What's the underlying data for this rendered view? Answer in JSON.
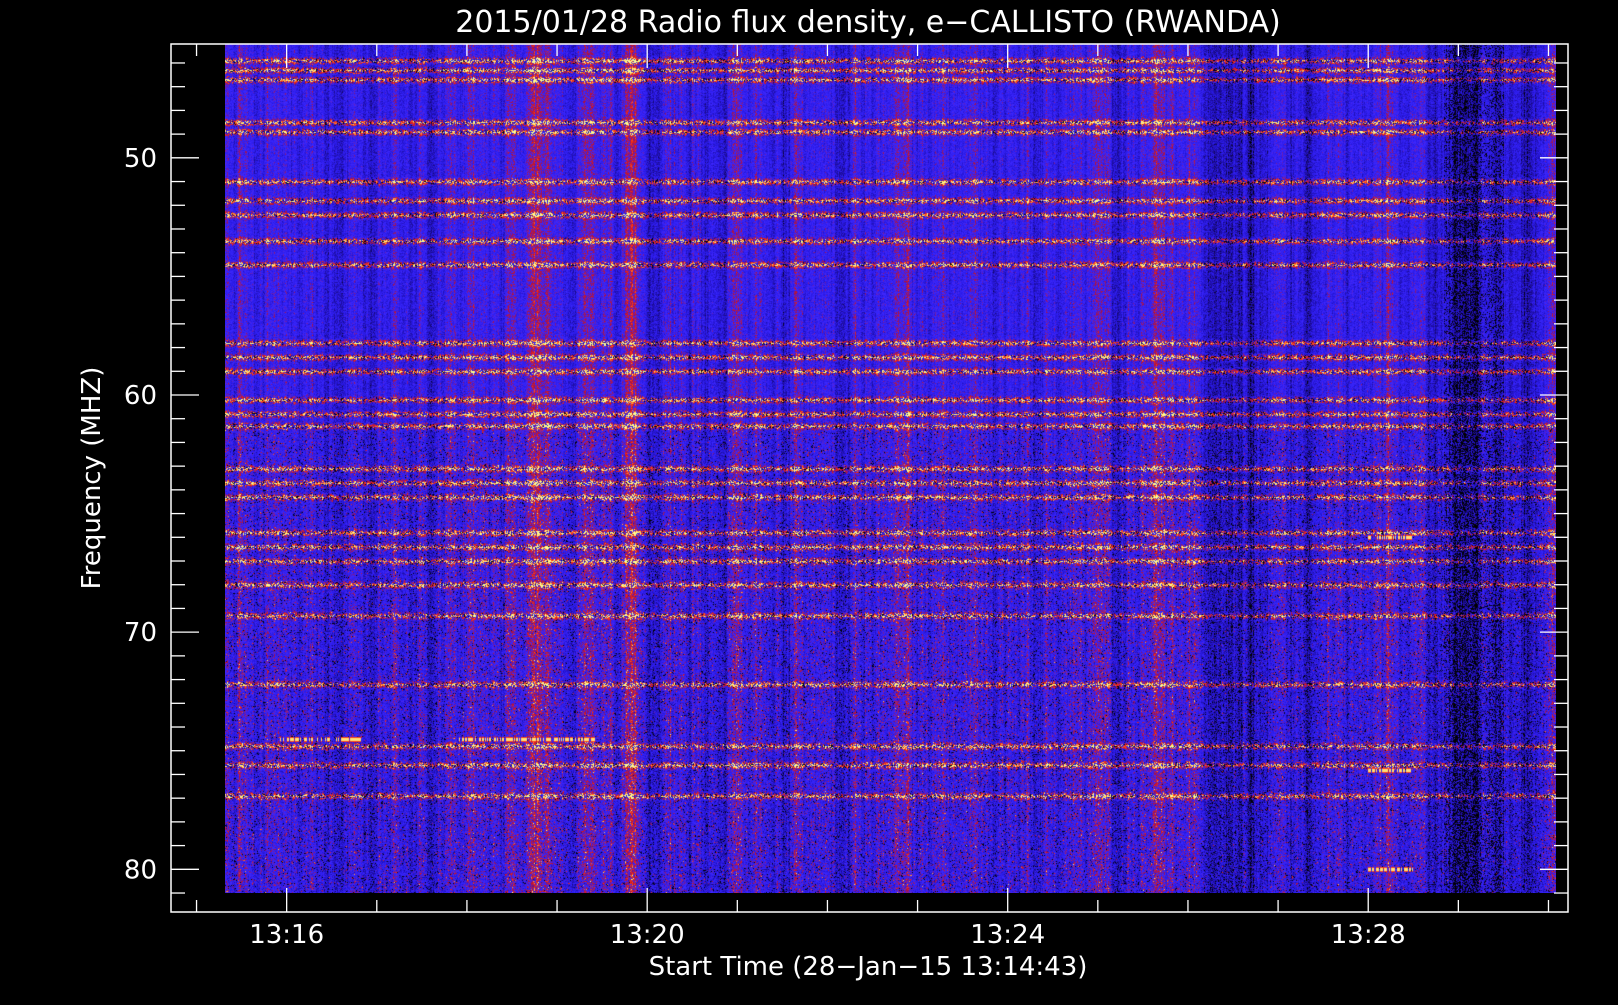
{
  "chart_data": {
    "type": "heatmap",
    "title": "2015/01/28  Radio flux density, e−CALLISTO (RWANDA)",
    "xlabel": "Start Time (28−Jan−15 13:14:43)",
    "ylabel": "Frequency (MHZ)",
    "xlim": [
      "13:14:43",
      "13:30:13"
    ],
    "ylim": [
      45.2,
      81.8
    ],
    "y_inverted": true,
    "x_ticks": [
      "13:16",
      "13:20",
      "13:24",
      "13:28"
    ],
    "y_ticks": [
      50,
      60,
      70,
      80
    ],
    "data_time_range": [
      "13:15:19",
      "13:30:05"
    ],
    "data_freq_range": [
      45.2,
      81.0
    ],
    "colormap": [
      "#000000",
      "#1a0a8c",
      "#2a1ae6",
      "#3c28ff",
      "#b0103a",
      "#ff3010",
      "#ffa040",
      "#ffff90"
    ],
    "rfi_bands_mhz": [
      45.9,
      46.3,
      46.7,
      48.5,
      48.9,
      51.0,
      51.8,
      52.4,
      53.5,
      54.5,
      57.8,
      58.4,
      59.0,
      60.2,
      60.8,
      61.3,
      63.1,
      63.7,
      64.3,
      65.8,
      66.4,
      67.0,
      68.0,
      69.3,
      72.2,
      74.8,
      75.6,
      76.9
    ],
    "bursts": [
      {
        "t_start": "13:15:55",
        "t_end": "13:16:50",
        "freq_mhz": 74.5
      },
      {
        "t_start": "13:17:55",
        "t_end": "13:19:25",
        "freq_mhz": 74.5
      },
      {
        "t_start": "13:28:00",
        "t_end": "13:28:30",
        "freq_mhz": 66.0
      },
      {
        "t_start": "13:28:00",
        "t_end": "13:28:30",
        "freq_mhz": 75.8
      },
      {
        "t_start": "13:28:00",
        "t_end": "13:28:30",
        "freq_mhz": 80.0
      }
    ]
  }
}
